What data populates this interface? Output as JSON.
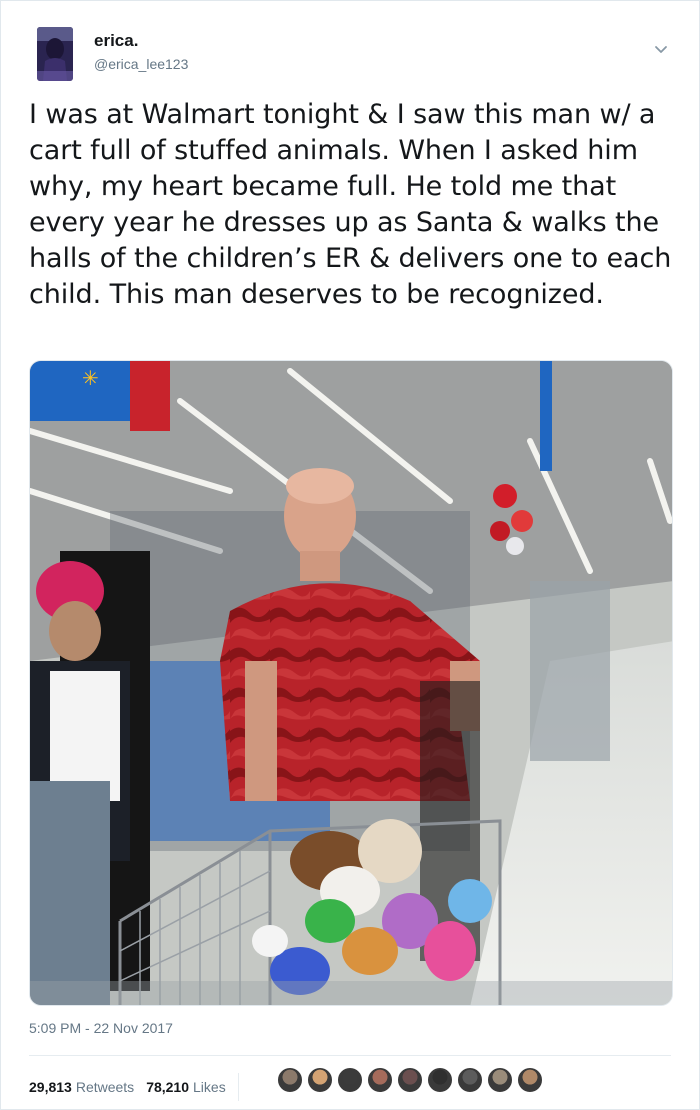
{
  "user": {
    "name": "erica.",
    "handle": "@erica_lee123"
  },
  "tweet": {
    "text": "I was at Walmart tonight & I saw this man w/ a cart full of stuffed animals. When I asked him why, my heart became full. He told me that every year he dresses up as Santa & walks the halls of the children’s ER & delivers one to each child. This man deserves to be recognized.",
    "timestamp": "5:09 PM - 22 Nov 2017"
  },
  "stats": {
    "retweets_count": "29,813",
    "retweets_label": "Retweets",
    "likes_count": "78,210",
    "likes_label": "Likes"
  },
  "colors": {
    "text": "#14171a",
    "secondary": "#657786",
    "divider": "#e6ecf0"
  },
  "likers": [
    "#8c7a6b",
    "#d4a373",
    "#3b3b3b",
    "#a56b5b",
    "#6b4f4f",
    "#2f2f2f",
    "#5c5c5c",
    "#9a8c7a",
    "#b08968"
  ]
}
